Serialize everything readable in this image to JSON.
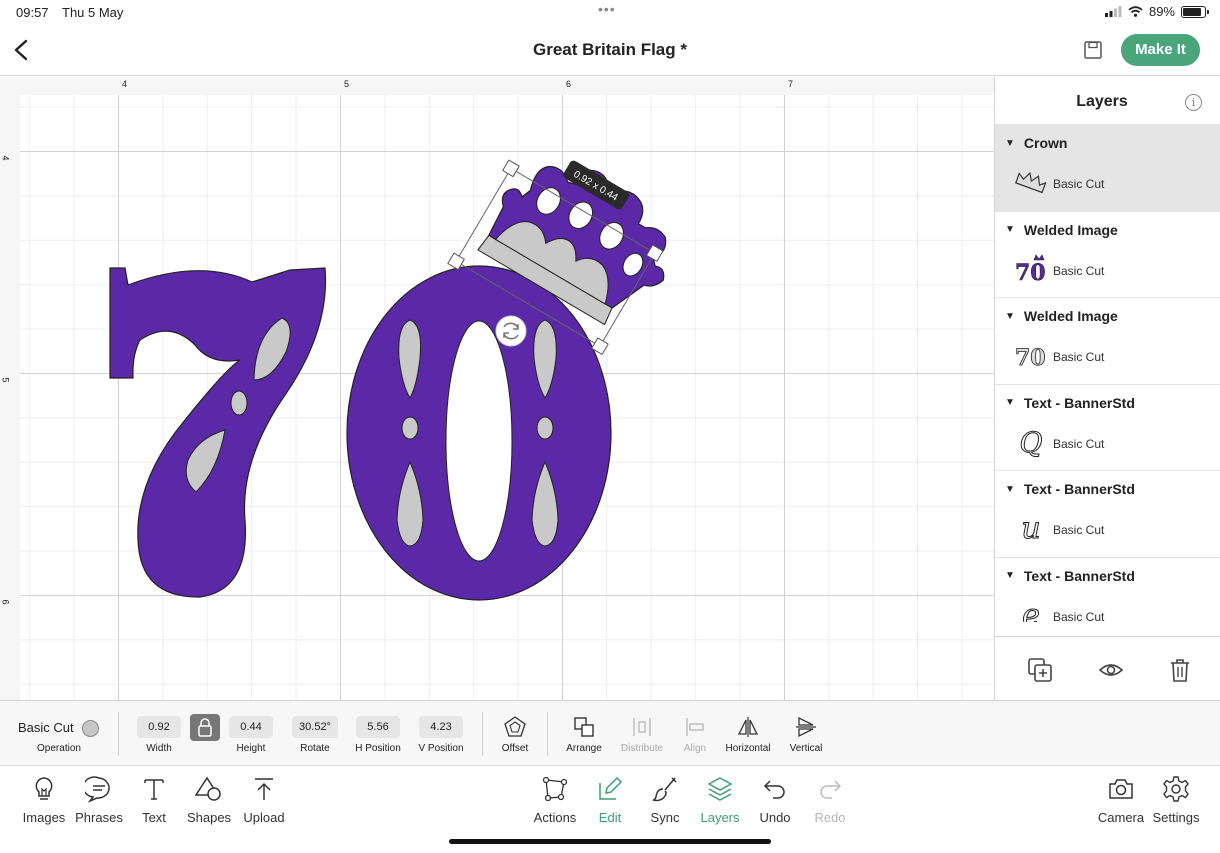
{
  "status_bar": {
    "time": "09:57",
    "date": "Thu 5 May",
    "battery": "89%"
  },
  "header": {
    "title": "Great Britain Flag *",
    "make_it_label": "Make It"
  },
  "canvas": {
    "ruler_top": [
      "4",
      "5",
      "6",
      "7"
    ],
    "ruler_left": [
      "4",
      "5",
      "6"
    ],
    "size_tooltip": "0.92 x 0.44",
    "colors": {
      "fill": "#5b28a8",
      "cutout": "#c9c9c9",
      "outline": "#222222"
    }
  },
  "layers": {
    "title": "Layers",
    "groups": [
      {
        "name": "Crown",
        "operation": "Basic Cut",
        "thumb": "crown-thumb",
        "selected": true
      },
      {
        "name": "Welded Image",
        "operation": "Basic Cut",
        "thumb": "70-crown-thumb"
      },
      {
        "name": "Welded Image",
        "operation": "Basic Cut",
        "thumb": "70-thumb"
      },
      {
        "name": "Text - BannerStd",
        "operation": "Basic Cut",
        "thumb": "Q",
        "glyph": "Q"
      },
      {
        "name": "Text - BannerStd",
        "operation": "Basic Cut",
        "thumb": "u",
        "glyph": "u"
      },
      {
        "name": "Text - BannerStd",
        "operation": "Basic Cut",
        "thumb": "e",
        "glyph": "e"
      }
    ]
  },
  "properties": {
    "operation_value": "Basic Cut",
    "operation_label": "Operation",
    "width_value": "0.92",
    "width_label": "Width",
    "height_value": "0.44",
    "height_label": "Height",
    "rotate_value": "30.52°",
    "rotate_label": "Rotate",
    "hpos_value": "5.56",
    "hpos_label": "H Position",
    "vpos_value": "4.23",
    "vpos_label": "V Position",
    "offset_label": "Offset",
    "arrange_label": "Arrange",
    "distribute_label": "Distribute",
    "align_label": "Align",
    "horizontal_label": "Horizontal",
    "vertical_label": "Vertical"
  },
  "toolbar": {
    "images": "Images",
    "phrases": "Phrases",
    "text": "Text",
    "shapes": "Shapes",
    "upload": "Upload",
    "actions": "Actions",
    "edit": "Edit",
    "sync": "Sync",
    "layers": "Layers",
    "undo": "Undo",
    "redo": "Redo",
    "camera": "Camera",
    "settings": "Settings",
    "accent_color": "#3f9f74"
  }
}
